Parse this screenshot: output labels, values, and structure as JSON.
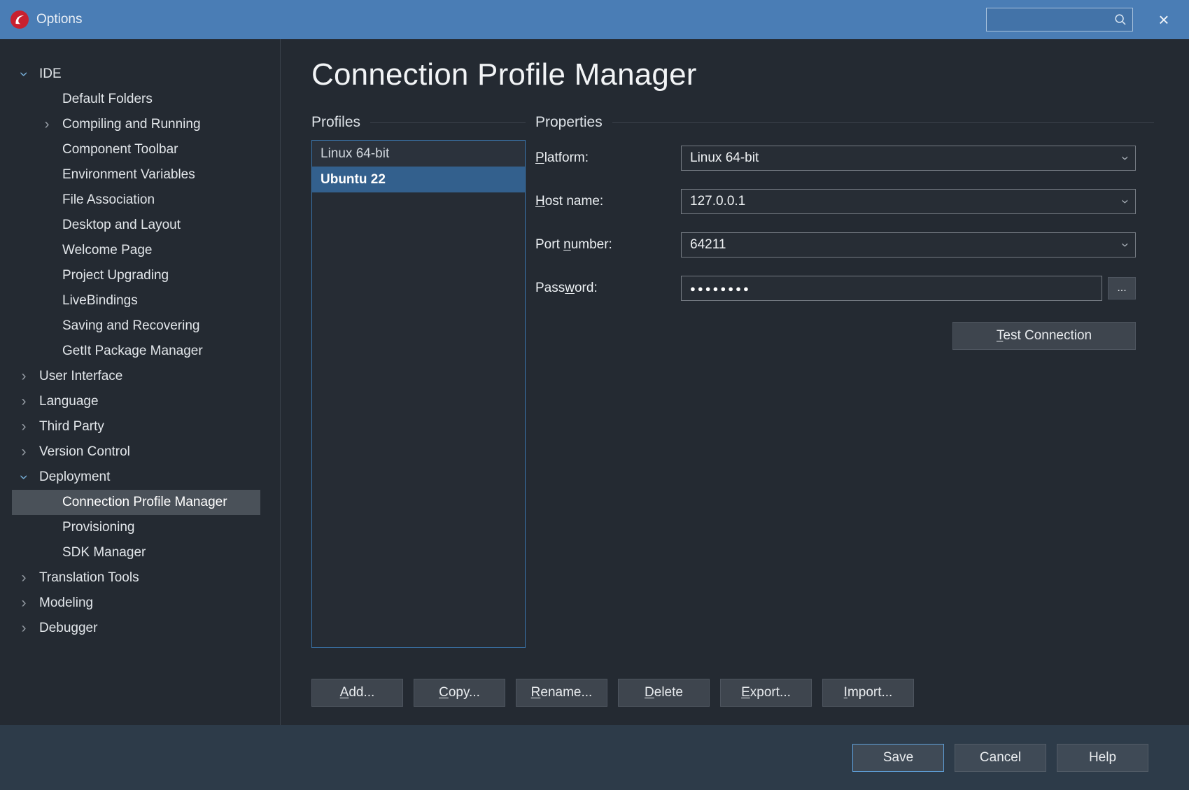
{
  "window": {
    "title": "Options",
    "close_icon": "×",
    "search_value": ""
  },
  "icons": {
    "chevron": "›",
    "combo_arrow": "›"
  },
  "colors": {
    "titlebar": "#4a7db5",
    "background": "#242a32",
    "sidebar_selected": "#4a5159",
    "list_border": "#3a74aa",
    "list_selected": "#33608d",
    "footer": "#2d3b49",
    "accent_border": "#5f9fd8",
    "logo_red": "#c8202f"
  },
  "header": {
    "title": "Connection Profile Manager"
  },
  "sidebar": {
    "items": [
      {
        "label": "IDE",
        "level": 0,
        "state": "expanded"
      },
      {
        "label": "Default Folders",
        "level": 1,
        "state": "leaf"
      },
      {
        "label": "Compiling and Running",
        "level": 1,
        "state": "collapsed"
      },
      {
        "label": "Component Toolbar",
        "level": 1,
        "state": "leaf"
      },
      {
        "label": "Environment Variables",
        "level": 1,
        "state": "leaf"
      },
      {
        "label": "File Association",
        "level": 1,
        "state": "leaf"
      },
      {
        "label": "Desktop and Layout",
        "level": 1,
        "state": "leaf"
      },
      {
        "label": "Welcome Page",
        "level": 1,
        "state": "leaf"
      },
      {
        "label": "Project Upgrading",
        "level": 1,
        "state": "leaf"
      },
      {
        "label": "LiveBindings",
        "level": 1,
        "state": "leaf"
      },
      {
        "label": "Saving and Recovering",
        "level": 1,
        "state": "leaf"
      },
      {
        "label": "GetIt Package Manager",
        "level": 1,
        "state": "leaf"
      },
      {
        "label": "User Interface",
        "level": 0,
        "state": "collapsed"
      },
      {
        "label": "Language",
        "level": 0,
        "state": "collapsed"
      },
      {
        "label": "Third Party",
        "level": 0,
        "state": "collapsed"
      },
      {
        "label": "Version Control",
        "level": 0,
        "state": "collapsed"
      },
      {
        "label": "Deployment",
        "level": 0,
        "state": "expanded"
      },
      {
        "label": "Connection Profile Manager",
        "level": 1,
        "state": "leaf",
        "selected": true
      },
      {
        "label": "Provisioning",
        "level": 1,
        "state": "leaf"
      },
      {
        "label": "SDK Manager",
        "level": 1,
        "state": "leaf"
      },
      {
        "label": "Translation Tools",
        "level": 0,
        "state": "collapsed"
      },
      {
        "label": "Modeling",
        "level": 0,
        "state": "collapsed"
      },
      {
        "label": "Debugger",
        "level": 0,
        "state": "collapsed"
      }
    ]
  },
  "profiles": {
    "section_label": "Profiles",
    "items": [
      {
        "label": "Linux 64-bit",
        "selected": false
      },
      {
        "label": "Ubuntu 22",
        "selected": true
      }
    ],
    "buttons": [
      {
        "pre": "",
        "key": "A",
        "post": "dd..."
      },
      {
        "pre": "",
        "key": "C",
        "post": "opy..."
      },
      {
        "pre": "",
        "key": "R",
        "post": "ename..."
      },
      {
        "pre": "",
        "key": "D",
        "post": "elete"
      },
      {
        "pre": "",
        "key": "E",
        "post": "xport..."
      },
      {
        "pre": "",
        "key": "I",
        "post": "mport..."
      }
    ]
  },
  "properties": {
    "section_label": "Properties",
    "fields": [
      {
        "label_pre": "",
        "label_key": "P",
        "label_post": "latform:",
        "value": "Linux 64-bit",
        "type": "combo"
      },
      {
        "label_pre": "",
        "label_key": "H",
        "label_post": "ost name:",
        "value": "127.0.0.1",
        "type": "combo"
      },
      {
        "label_pre": "Port ",
        "label_key": "n",
        "label_post": "umber:",
        "value": "64211",
        "type": "combo"
      },
      {
        "label_pre": "Pass",
        "label_key": "w",
        "label_post": "ord:",
        "value": "●●●●●●●●",
        "type": "password"
      }
    ],
    "ellipsis_button": "...",
    "test_button": {
      "pre": "",
      "key": "T",
      "post": "est Connection"
    }
  },
  "footer": {
    "save": "Save",
    "cancel": "Cancel",
    "help": "Help"
  }
}
